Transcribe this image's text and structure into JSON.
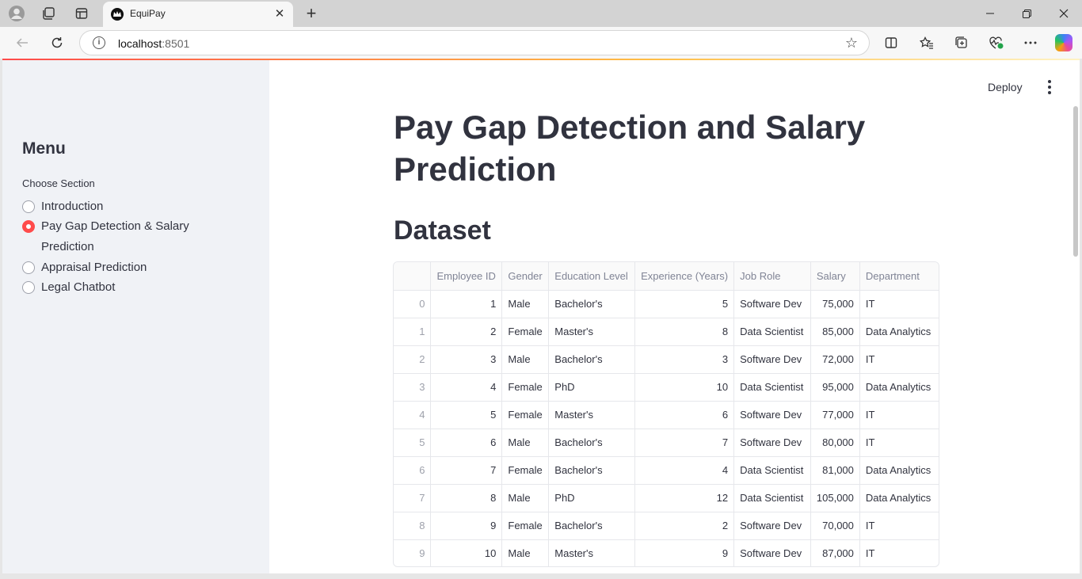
{
  "browser": {
    "tab_title": "EquiPay",
    "url_host": "localhost",
    "url_port": ":8501"
  },
  "sidebar": {
    "menu_title": "Menu",
    "choose_label": "Choose Section",
    "options": [
      {
        "label": "Introduction",
        "selected": false
      },
      {
        "label": "Pay Gap Detection & Salary Prediction",
        "selected": true
      },
      {
        "label": "Appraisal Prediction",
        "selected": false
      },
      {
        "label": "Legal Chatbot",
        "selected": false
      }
    ]
  },
  "header": {
    "deploy_label": "Deploy"
  },
  "main": {
    "page_title": "Pay Gap Detection and Salary Prediction",
    "section_title": "Dataset",
    "table": {
      "columns": [
        "",
        "Employee ID",
        "Gender",
        "Education Level",
        "Experience (Years)",
        "Job Role",
        "Salary",
        "Department"
      ],
      "rows": [
        [
          "0",
          "1",
          "Male",
          "Bachelor's",
          "5",
          "Software Dev",
          "75,000",
          "IT"
        ],
        [
          "1",
          "2",
          "Female",
          "Master's",
          "8",
          "Data Scientist",
          "85,000",
          "Data Analytics"
        ],
        [
          "2",
          "3",
          "Male",
          "Bachelor's",
          "3",
          "Software Dev",
          "72,000",
          "IT"
        ],
        [
          "3",
          "4",
          "Female",
          "PhD",
          "10",
          "Data Scientist",
          "95,000",
          "Data Analytics"
        ],
        [
          "4",
          "5",
          "Female",
          "Master's",
          "6",
          "Software Dev",
          "77,000",
          "IT"
        ],
        [
          "5",
          "6",
          "Male",
          "Bachelor's",
          "7",
          "Software Dev",
          "80,000",
          "IT"
        ],
        [
          "6",
          "7",
          "Female",
          "Bachelor's",
          "4",
          "Data Scientist",
          "81,000",
          "Data Analytics"
        ],
        [
          "7",
          "8",
          "Male",
          "PhD",
          "12",
          "Data Scientist",
          "105,000",
          "Data Analytics"
        ],
        [
          "8",
          "9",
          "Female",
          "Bachelor's",
          "2",
          "Software Dev",
          "70,000",
          "IT"
        ],
        [
          "9",
          "10",
          "Male",
          "Master's",
          "9",
          "Software Dev",
          "87,000",
          "IT"
        ]
      ]
    }
  },
  "colors": {
    "accent": "#ff4b4b",
    "sidebar_bg": "#f0f2f6",
    "text": "#31333f"
  }
}
